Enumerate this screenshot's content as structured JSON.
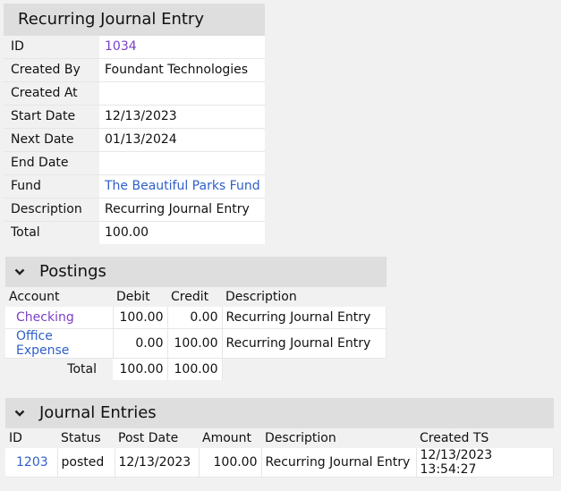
{
  "detail": {
    "title": "Recurring Journal Entry",
    "rows": [
      {
        "label": "ID",
        "value": "1034"
      },
      {
        "label": "Created By",
        "value": "Foundant Technologies"
      },
      {
        "label": "Created At",
        "value": ""
      },
      {
        "label": "Start Date",
        "value": "12/13/2023"
      },
      {
        "label": "Next Date",
        "value": "01/13/2024"
      },
      {
        "label": "End Date",
        "value": ""
      },
      {
        "label": "Fund",
        "value": "The Beautiful Parks Fund"
      },
      {
        "label": "Description",
        "value": "Recurring Journal Entry"
      },
      {
        "label": "Total",
        "value": "100.00"
      }
    ]
  },
  "postings": {
    "title": "Postings",
    "columns": [
      "Account",
      "Debit",
      "Credit",
      "Description"
    ],
    "rows": [
      {
        "account": "Checking",
        "debit": "100.00",
        "credit": "0.00",
        "description": "Recurring Journal Entry"
      },
      {
        "account": "Office Expense",
        "debit": "0.00",
        "credit": "100.00",
        "description": "Recurring Journal Entry"
      }
    ],
    "total_label": "Total",
    "total_debit": "100.00",
    "total_credit": "100.00"
  },
  "journal": {
    "title": "Journal Entries",
    "columns": [
      "ID",
      "Status",
      "Post Date",
      "Amount",
      "Description",
      "Created TS"
    ],
    "rows": [
      {
        "id": "1203",
        "status": "posted",
        "post_date": "12/13/2023",
        "amount": "100.00",
        "description": "Recurring Journal Entry",
        "created_ts": "12/13/2023 13:54:27"
      }
    ]
  },
  "colors": {
    "link": "#2f5fc9",
    "visited_link": "#7b3fc9",
    "header_bg": "#dedede",
    "page_bg": "#f1f1f1"
  },
  "icons": {
    "collapse": "chevron-down-icon"
  }
}
